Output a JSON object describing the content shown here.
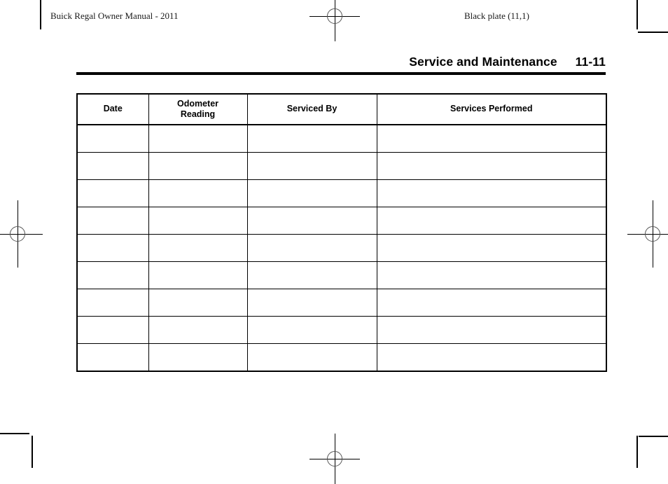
{
  "page": {
    "running_head_left": "Buick Regal Owner Manual - 2011",
    "running_head_right": "Black plate (11,1)",
    "section_title": "Service and Maintenance",
    "page_number": "11-11"
  },
  "table": {
    "columns": [
      {
        "key": "date",
        "label_lines": [
          "Date"
        ]
      },
      {
        "key": "odometer",
        "label_lines": [
          "Odometer",
          "Reading"
        ]
      },
      {
        "key": "serviced_by",
        "label_lines": [
          "Serviced By"
        ]
      },
      {
        "key": "services_performed",
        "label_lines": [
          "Services Performed"
        ]
      }
    ],
    "headers": {
      "date": "Date",
      "odometer_line1": "Odometer",
      "odometer_line2": "Reading",
      "serviced_by": "Serviced By",
      "services_performed": "Services Performed"
    },
    "row_count": 9,
    "rows": [
      {
        "date": "",
        "odometer": "",
        "serviced_by": "",
        "services_performed": ""
      },
      {
        "date": "",
        "odometer": "",
        "serviced_by": "",
        "services_performed": ""
      },
      {
        "date": "",
        "odometer": "",
        "serviced_by": "",
        "services_performed": ""
      },
      {
        "date": "",
        "odometer": "",
        "serviced_by": "",
        "services_performed": ""
      },
      {
        "date": "",
        "odometer": "",
        "serviced_by": "",
        "services_performed": ""
      },
      {
        "date": "",
        "odometer": "",
        "serviced_by": "",
        "services_performed": ""
      },
      {
        "date": "",
        "odometer": "",
        "serviced_by": "",
        "services_performed": ""
      },
      {
        "date": "",
        "odometer": "",
        "serviced_by": "",
        "services_performed": ""
      },
      {
        "date": "",
        "odometer": "",
        "serviced_by": "",
        "services_performed": ""
      }
    ]
  },
  "colors": {
    "ink": "#000000",
    "paper": "#ffffff",
    "reg_mark_gray": "#555555"
  },
  "printer_marks": {
    "crop_mark_names": [
      "crop-mark-top-left",
      "crop-mark-top-right",
      "crop-mark-bottom-left",
      "crop-mark-bottom-right"
    ],
    "registration_mark_names": [
      "registration-mark-top",
      "registration-mark-bottom",
      "registration-mark-left",
      "registration-mark-right"
    ]
  }
}
